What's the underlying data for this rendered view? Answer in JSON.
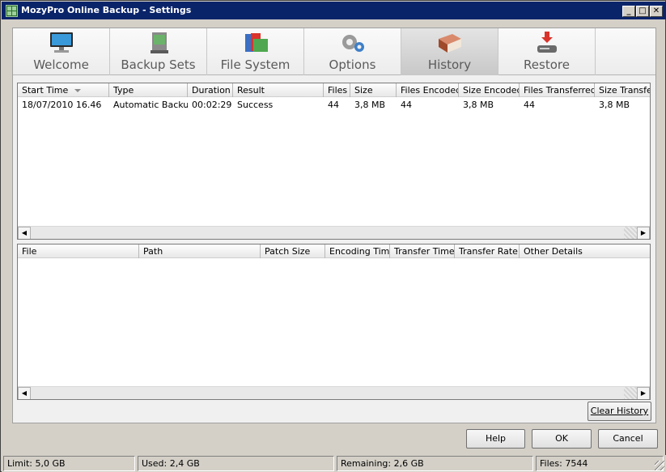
{
  "window": {
    "title": "MozyPro Online Backup - Settings"
  },
  "titlebar_buttons": {
    "minimize": "_",
    "maximize": "□",
    "close": "✕"
  },
  "tabs": [
    {
      "label": "Welcome",
      "icon": "monitor-icon",
      "active": false
    },
    {
      "label": "Backup Sets",
      "icon": "backup-sets-icon",
      "active": false
    },
    {
      "label": "File System",
      "icon": "folders-icon",
      "active": false
    },
    {
      "label": "Options",
      "icon": "gears-icon",
      "active": false
    },
    {
      "label": "History",
      "icon": "book-icon",
      "active": true
    },
    {
      "label": "Restore",
      "icon": "restore-drive-icon",
      "active": false
    }
  ],
  "history_table": {
    "columns": [
      "Start Time",
      "Type",
      "Duration",
      "Result",
      "Files",
      "Size",
      "Files Encoded",
      "Size Encoded",
      "Files Transferred",
      "Size Transfer"
    ],
    "sort_column": "Start Time",
    "rows": [
      [
        "18/07/2010 16.46",
        "Automatic Backup",
        "00:02:29",
        "Success",
        "44",
        "3,8 MB",
        "44",
        "3,8 MB",
        "44",
        "3,8 MB"
      ]
    ]
  },
  "detail_table": {
    "columns": [
      "File",
      "Path",
      "Patch Size",
      "Encoding Time",
      "Transfer Time",
      "Transfer Rate",
      "Other Details"
    ],
    "rows": []
  },
  "scroll_arrows": {
    "left": "◀",
    "right": "▶"
  },
  "buttons": {
    "clear_history": "Clear History",
    "help": "Help",
    "ok": "OK",
    "cancel": "Cancel"
  },
  "status_bar": {
    "limit": "Limit: 5,0 GB",
    "used": "Used: 2,4 GB",
    "remaining": "Remaining: 2,6 GB",
    "files": "Files: 7544"
  },
  "colors": {
    "titlebar": "#0a246a",
    "window": "#d4d0c8",
    "panel": "#f0f0f0"
  }
}
